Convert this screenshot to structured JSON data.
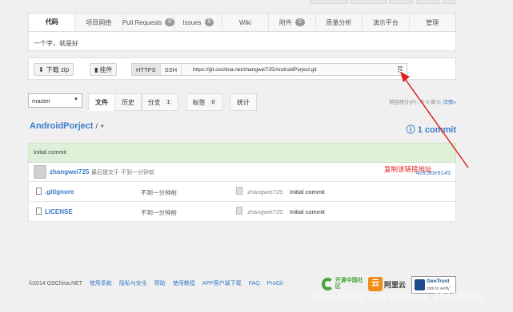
{
  "tabs": [
    {
      "label": "代码",
      "active": true
    },
    {
      "label": "项目网络"
    },
    {
      "label": "Pull Requests",
      "badge": "0"
    },
    {
      "label": "Issues",
      "badge": "0"
    },
    {
      "label": "Wiki"
    },
    {
      "label": "附件",
      "badge": "0"
    },
    {
      "label": "质量分析"
    },
    {
      "label": "演示平台"
    },
    {
      "label": "管理"
    }
  ],
  "description": "一个字，就是好",
  "clone": {
    "download_label": "下载 zip",
    "widget_label": "挂件",
    "https_label": "HTTPS",
    "ssh_label": "SSH",
    "url": "https://git.oschina.net/zhangwei725/AndroidPorject.git",
    "copy_icon": "copy-icon"
  },
  "toolbar": {
    "branch": "master",
    "tabs": [
      {
        "label": "文件",
        "active": true
      },
      {
        "label": "历史"
      },
      {
        "label": "分支",
        "count": "1"
      },
      {
        "label": "标签",
        "count": "0"
      },
      {
        "label": "统计"
      }
    ],
    "stats_text": "项目统计(P): 今 0 周 0; ",
    "stats_link": "详情»"
  },
  "repo": {
    "name": "AndroidPorject",
    "sep": "/",
    "plus": "+",
    "commits_icon": "ⓘ",
    "commits": "1 commit"
  },
  "last_commit": {
    "message": "Initial commit",
    "author": "zhangwei725",
    "after": "最后提交于 不到一分钟前",
    "hash": "4cfc90e9149"
  },
  "files": [
    {
      "name": ".gitignore",
      "time": "不到一分钟前",
      "author": "zhangwei725",
      "message": "Initial commit"
    },
    {
      "name": "LICENSE",
      "time": "不到一分钟前",
      "author": "zhangwei725",
      "message": "Initial commit"
    }
  ],
  "footer": {
    "copyright": "©2014 OSChina.NET",
    "links": [
      "使用条款",
      "隐私与安全",
      "帮助",
      "使用教程",
      "APP客户端下载",
      "FAQ",
      "ProGit"
    ],
    "logo1_text": "开源中国社区",
    "logo2_badge": "云",
    "logo2_text": "阿里云",
    "logo3_text": "GeoTrust",
    "logo3_sub": "click to verify"
  },
  "annotation": "复制该链接地址",
  "watermark": "https://blog.csdn.net/qq_35636998",
  "colors": {
    "accent": "#3a7bc8",
    "annotation": "#e02020",
    "commit_bg": "#dff0d8"
  }
}
